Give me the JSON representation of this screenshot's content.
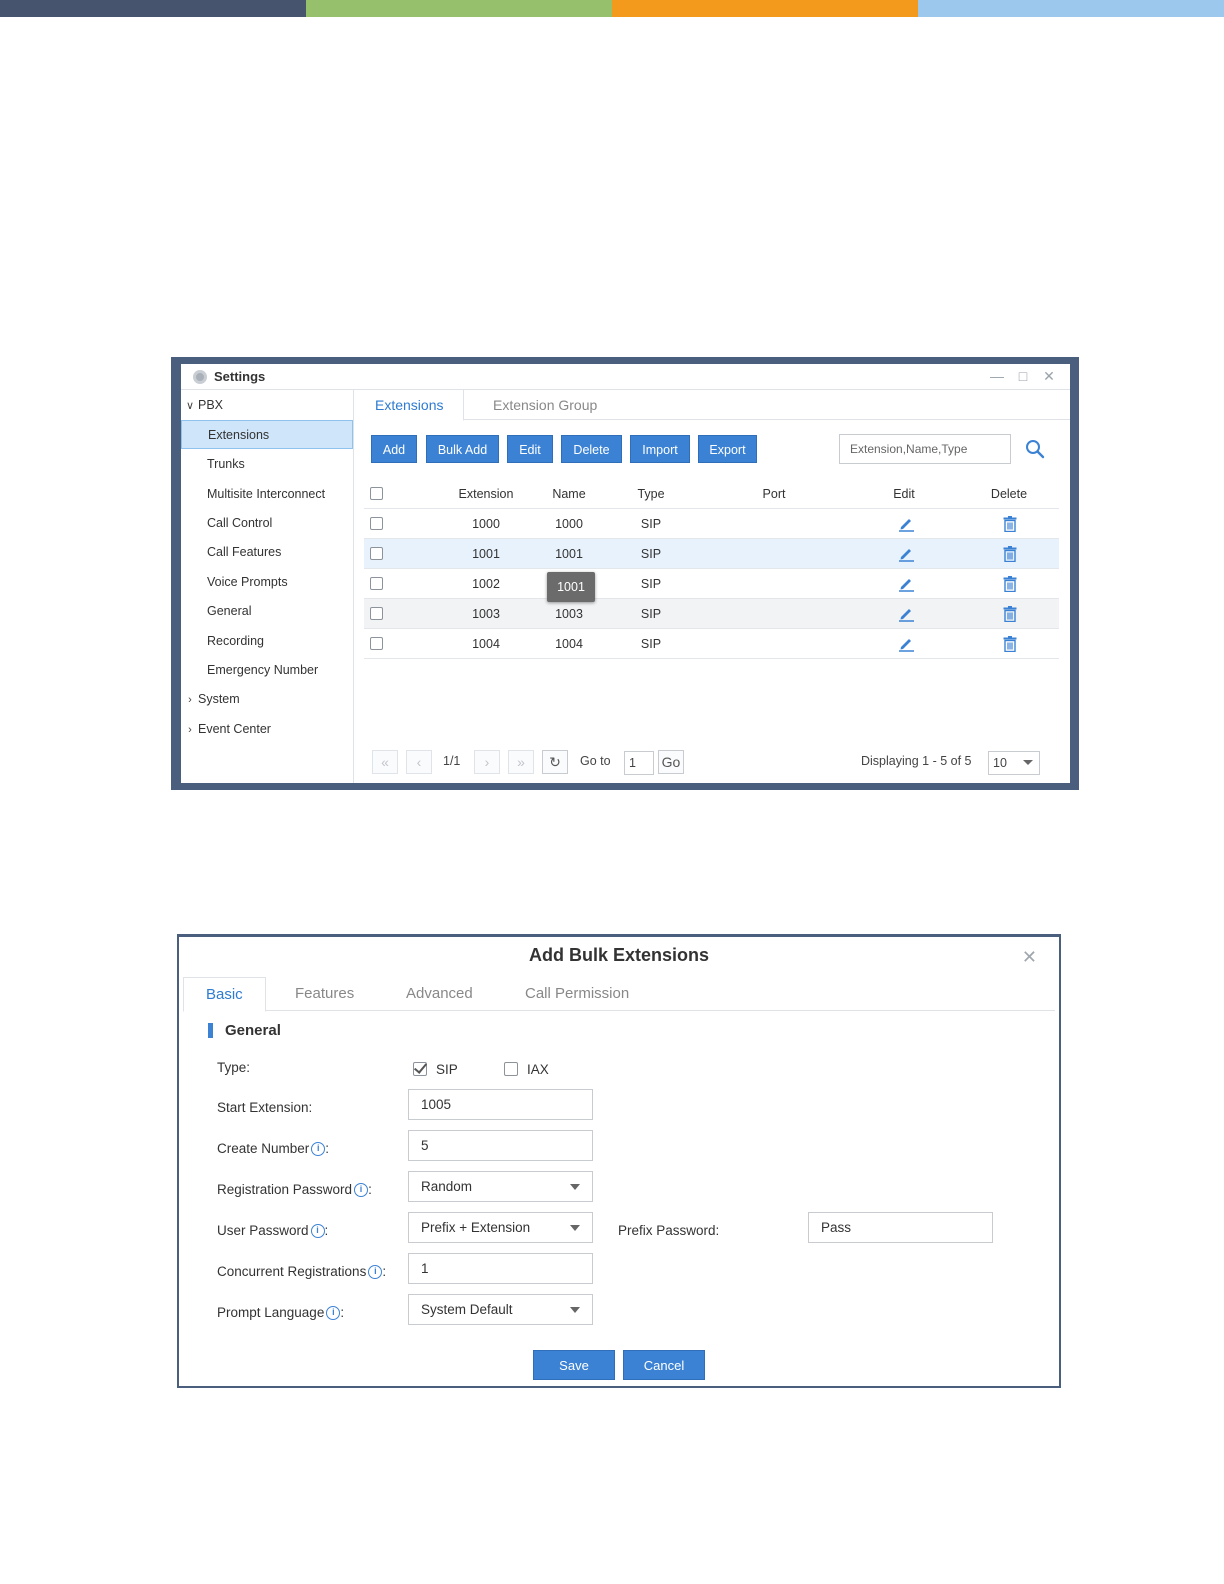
{
  "colors": {
    "bar": [
      "#46546e",
      "#96c06b",
      "#f39a1d",
      "#9dc8ee"
    ],
    "accent": "#3b82d4",
    "frame": "#4a5f7d"
  },
  "settings": {
    "title": "Settings",
    "icon": "gear-icon",
    "window_controls": [
      "minimize-icon",
      "maximize-icon",
      "close-icon"
    ],
    "sidebar": {
      "pbx": "PBX",
      "items": [
        "Extensions",
        "Trunks",
        "Multisite Interconnect",
        "Call Control",
        "Call Features",
        "Voice Prompts",
        "General",
        "Recording",
        "Emergency Number"
      ],
      "system": "System",
      "event_center": "Event Center"
    },
    "tabs": [
      "Extensions",
      "Extension Group"
    ],
    "toolbar": {
      "add": "Add",
      "bulk_add": "Bulk Add",
      "edit": "Edit",
      "delete": "Delete",
      "import": "Import",
      "export": "Export",
      "search_placeholder": "Extension,Name,Type"
    },
    "table": {
      "headers": {
        "extension": "Extension",
        "name": "Name",
        "type": "Type",
        "port": "Port",
        "edit": "Edit",
        "delete": "Delete"
      },
      "rows": [
        {
          "extension": "1000",
          "name": "1000",
          "type": "SIP",
          "port": ""
        },
        {
          "extension": "1001",
          "name": "1001",
          "type": "SIP",
          "port": ""
        },
        {
          "extension": "1002",
          "name": "",
          "type": "SIP",
          "port": ""
        },
        {
          "extension": "1003",
          "name": "1003",
          "type": "SIP",
          "port": ""
        },
        {
          "extension": "1004",
          "name": "1004",
          "type": "SIP",
          "port": ""
        }
      ],
      "tooltip": "1001"
    },
    "pager": {
      "page": "1/1",
      "goto_label": "Go to",
      "goto_value": "1",
      "go_button": "Go",
      "displaying": "Displaying 1 - 5 of 5",
      "page_size": "10"
    }
  },
  "dialog": {
    "title": "Add Bulk Extensions",
    "tabs": [
      "Basic",
      "Features",
      "Advanced",
      "Call Permission"
    ],
    "section": "General",
    "fields": {
      "type_label": "Type:",
      "type_sip": "SIP",
      "type_iax": "IAX",
      "start_extension_label": "Start Extension:",
      "start_extension_value": "1005",
      "create_number_label": "Create Number",
      "create_number_value": "5",
      "registration_password_label": "Registration Password",
      "registration_password_value": "Random",
      "user_password_label": "User Password",
      "user_password_value": "Prefix + Extension",
      "prefix_password_label": "Prefix Password:",
      "prefix_password_value": "Pass",
      "concurrent_registrations_label": "Concurrent Registrations",
      "concurrent_registrations_value": "1",
      "prompt_language_label": "Prompt Language",
      "prompt_language_value": "System Default"
    },
    "info_glyph": "i",
    "colon": ":",
    "save": "Save",
    "cancel": "Cancel"
  }
}
